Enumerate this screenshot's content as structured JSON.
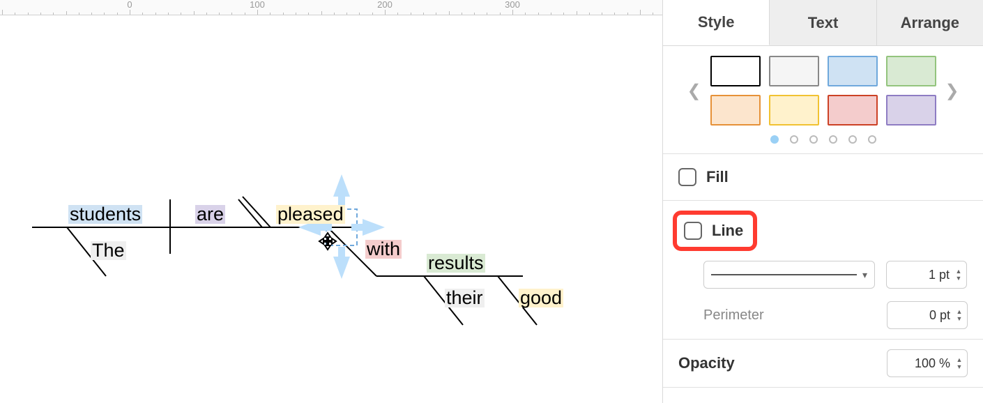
{
  "ruler": {
    "labels": [
      "0",
      "100",
      "200",
      "300"
    ]
  },
  "diagram": {
    "words": {
      "students": "students",
      "are": "are",
      "pleased": "pleased",
      "the": "The",
      "with": "with",
      "results": "results",
      "their": "their",
      "good": "good"
    }
  },
  "panel": {
    "tabs": {
      "style": "Style",
      "text": "Text",
      "arrange": "Arrange"
    },
    "palette": [
      {
        "fill": "#ffffff",
        "border": "#000000"
      },
      {
        "fill": "#f5f5f5",
        "border": "#888888"
      },
      {
        "fill": "#cfe2f3",
        "border": "#6fa8dc"
      },
      {
        "fill": "#d9ead3",
        "border": "#93c47d"
      },
      {
        "fill": "#fce5cd",
        "border": "#e69138"
      },
      {
        "fill": "#fff2cc",
        "border": "#f1c232"
      },
      {
        "fill": "#f4cccc",
        "border": "#cc4125"
      },
      {
        "fill": "#d9d2e9",
        "border": "#8e7cc3"
      }
    ],
    "dots_total": 6,
    "dots_active_index": 0,
    "fill_label": "Fill",
    "line_label": "Line",
    "line_width": "1 pt",
    "perimeter_label": "Perimeter",
    "perimeter_value": "0 pt",
    "opacity_label": "Opacity",
    "opacity_value": "100 %"
  }
}
